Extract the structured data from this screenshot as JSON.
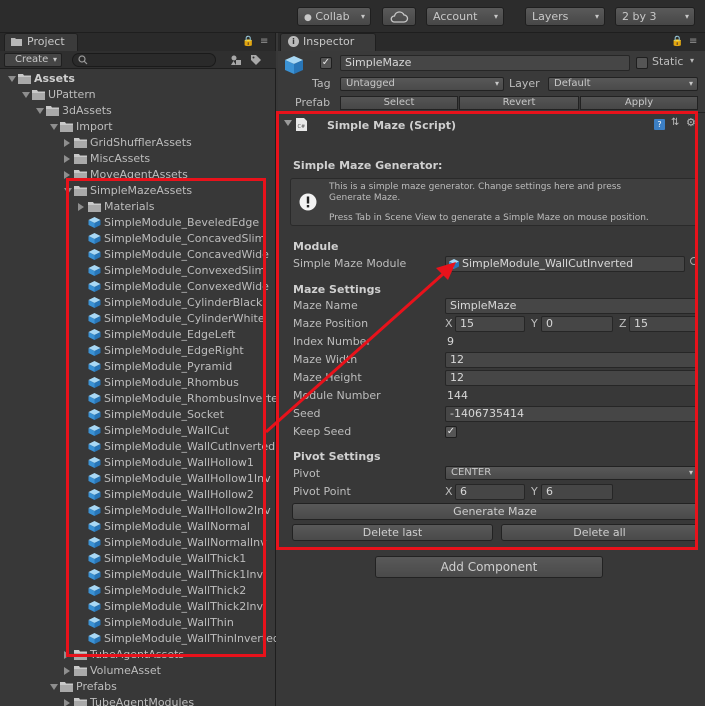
{
  "toolbar": {
    "collab": "Collab",
    "account": "Account",
    "layers": "Layers",
    "layout": "2 by 3"
  },
  "project": {
    "tab_label": "Project",
    "create_label": "Create",
    "tree": [
      {
        "label": "Assets",
        "depth": 0,
        "open": true,
        "bold": true,
        "icon": "folder-icon"
      },
      {
        "label": "UPattern",
        "depth": 1,
        "open": true,
        "icon": "folder-icon"
      },
      {
        "label": "3dAssets",
        "depth": 2,
        "open": true,
        "icon": "folder-icon"
      },
      {
        "label": "Import",
        "depth": 3,
        "open": true,
        "icon": "folder-icon"
      },
      {
        "label": "GridShufflerAssets",
        "depth": 4,
        "open": false,
        "icon": "folder-icon"
      },
      {
        "label": "MiscAssets",
        "depth": 4,
        "open": false,
        "icon": "folder-icon"
      },
      {
        "label": "MoveAgentAssets",
        "depth": 4,
        "open": false,
        "icon": "folder-icon"
      },
      {
        "label": "SimpleMazeAssets",
        "depth": 4,
        "open": true,
        "icon": "folder-icon"
      },
      {
        "label": "Materials",
        "depth": 5,
        "open": false,
        "icon": "folder-icon"
      },
      {
        "label": "SimpleModule_BeveledEdge",
        "depth": 5,
        "open": false,
        "icon": "prefab-icon"
      },
      {
        "label": "SimpleModule_ConcavedSlim",
        "depth": 5,
        "open": false,
        "icon": "prefab-icon"
      },
      {
        "label": "SimpleModule_ConcavedWide",
        "depth": 5,
        "open": false,
        "icon": "prefab-icon"
      },
      {
        "label": "SimpleModule_ConvexedSlim",
        "depth": 5,
        "open": false,
        "icon": "prefab-icon"
      },
      {
        "label": "SimpleModule_ConvexedWide",
        "depth": 5,
        "open": false,
        "icon": "prefab-icon"
      },
      {
        "label": "SimpleModule_CylinderBlack",
        "depth": 5,
        "open": false,
        "icon": "prefab-icon"
      },
      {
        "label": "SimpleModule_CylinderWhite",
        "depth": 5,
        "open": false,
        "icon": "prefab-icon"
      },
      {
        "label": "SimpleModule_EdgeLeft",
        "depth": 5,
        "open": false,
        "icon": "prefab-icon"
      },
      {
        "label": "SimpleModule_EdgeRight",
        "depth": 5,
        "open": false,
        "icon": "prefab-icon"
      },
      {
        "label": "SimpleModule_Pyramid",
        "depth": 5,
        "open": false,
        "icon": "prefab-icon"
      },
      {
        "label": "SimpleModule_Rhombus",
        "depth": 5,
        "open": false,
        "icon": "prefab-icon"
      },
      {
        "label": "SimpleModule_RhombusInverted",
        "depth": 5,
        "open": false,
        "icon": "prefab-icon"
      },
      {
        "label": "SimpleModule_Socket",
        "depth": 5,
        "open": false,
        "icon": "prefab-icon"
      },
      {
        "label": "SimpleModule_WallCut",
        "depth": 5,
        "open": false,
        "icon": "prefab-icon"
      },
      {
        "label": "SimpleModule_WallCutInverted",
        "depth": 5,
        "open": false,
        "icon": "prefab-icon"
      },
      {
        "label": "SimpleModule_WallHollow1",
        "depth": 5,
        "open": false,
        "icon": "prefab-icon"
      },
      {
        "label": "SimpleModule_WallHollow1Inv",
        "depth": 5,
        "open": false,
        "icon": "prefab-icon"
      },
      {
        "label": "SimpleModule_WallHollow2",
        "depth": 5,
        "open": false,
        "icon": "prefab-icon"
      },
      {
        "label": "SimpleModule_WallHollow2Inv",
        "depth": 5,
        "open": false,
        "icon": "prefab-icon"
      },
      {
        "label": "SimpleModule_WallNormal",
        "depth": 5,
        "open": false,
        "icon": "prefab-icon"
      },
      {
        "label": "SimpleModule_WallNormalInv",
        "depth": 5,
        "open": false,
        "icon": "prefab-icon"
      },
      {
        "label": "SimpleModule_WallThick1",
        "depth": 5,
        "open": false,
        "icon": "prefab-icon"
      },
      {
        "label": "SimpleModule_WallThick1Inv",
        "depth": 5,
        "open": false,
        "icon": "prefab-icon"
      },
      {
        "label": "SimpleModule_WallThick2",
        "depth": 5,
        "open": false,
        "icon": "prefab-icon"
      },
      {
        "label": "SimpleModule_WallThick2Inv",
        "depth": 5,
        "open": false,
        "icon": "prefab-icon"
      },
      {
        "label": "SimpleModule_WallThin",
        "depth": 5,
        "open": false,
        "icon": "prefab-icon"
      },
      {
        "label": "SimpleModule_WallThinInverted",
        "depth": 5,
        "open": false,
        "icon": "prefab-icon"
      },
      {
        "label": "TubeAgentAssets",
        "depth": 4,
        "open": false,
        "icon": "folder-icon"
      },
      {
        "label": "VolumeAsset",
        "depth": 4,
        "open": false,
        "icon": "folder-icon"
      },
      {
        "label": "Prefabs",
        "depth": 3,
        "open": true,
        "icon": "folder-icon"
      },
      {
        "label": "TubeAgentModules",
        "depth": 4,
        "open": false,
        "icon": "folder-icon"
      }
    ]
  },
  "inspector": {
    "tab_label": "Inspector",
    "object_name": "SimpleMaze",
    "static_label": "Static",
    "tag_label": "Tag",
    "tag_value": "Untagged",
    "layer_label": "Layer",
    "layer_value": "Default",
    "prefab_label": "Prefab",
    "prefab_select": "Select",
    "prefab_revert": "Revert",
    "prefab_apply": "Apply",
    "component_title": "Simple Maze (Script)",
    "generator_heading": "Simple Maze Generator:",
    "help_line1": "This is a simple maze generator. Change settings here and press",
    "help_line2": "Generate Maze.",
    "help_line3": "Press Tab in Scene View to generate a Simple Maze on mouse position.",
    "module_heading": "Module",
    "module_label": "Simple Maze Module",
    "module_value": "SimpleModule_WallCutInverted",
    "maze_heading": "Maze Settings",
    "maze_name_label": "Maze Name",
    "maze_name_value": "SimpleMaze",
    "maze_position_label": "Maze Position",
    "pos_x_label": "X",
    "pos_x": "15",
    "pos_y_label": "Y",
    "pos_y": "0",
    "pos_z_label": "Z",
    "pos_z": "15",
    "index_label": "Index Number",
    "index_value": "9",
    "width_label": "Maze Width",
    "width_value": "12",
    "height_label": "Maze Height",
    "height_value": "12",
    "module_number_label": "Module Number",
    "module_number_value": "144",
    "seed_label": "Seed",
    "seed_value": "-1406735414",
    "keep_seed_label": "Keep Seed",
    "keep_seed_checked": true,
    "pivot_heading": "Pivot Settings",
    "pivot_label": "Pivot",
    "pivot_value": "CENTER",
    "pivot_point_label": "Pivot Point",
    "pp_x_label": "X",
    "pp_x": "6",
    "pp_y_label": "Y",
    "pp_y": "6",
    "generate_label": "Generate Maze",
    "delete_last_label": "Delete last",
    "delete_all_label": "Delete all",
    "add_component_label": "Add Component"
  },
  "colors": {
    "highlight": "#e8121b",
    "folder": "#c9c9c9",
    "prefab": "#5aaee6"
  }
}
